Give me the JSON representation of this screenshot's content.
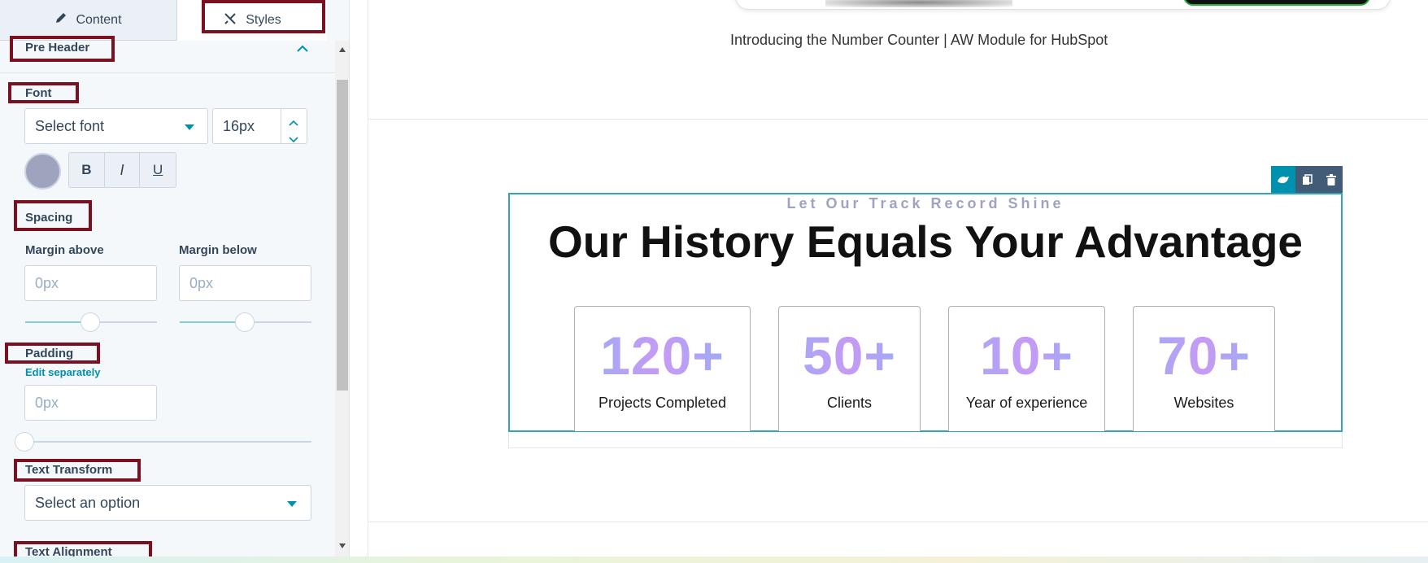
{
  "tabs": {
    "content": "Content",
    "styles": "Styles"
  },
  "pre_header": {
    "title": "Pre Header"
  },
  "font": {
    "label": "Font",
    "select_placeholder": "Select font",
    "size_value": "16px",
    "bold": "B",
    "italic": "I",
    "underline": "U",
    "color": "#a0a3bd"
  },
  "spacing": {
    "label": "Spacing",
    "margin_above_label": "Margin above",
    "margin_below_label": "Margin below",
    "margin_above_placeholder": "0px",
    "margin_below_placeholder": "0px"
  },
  "padding": {
    "label": "Padding",
    "edit_separately": "Edit separately",
    "placeholder": "0px"
  },
  "text_transform": {
    "label": "Text Transform",
    "select_placeholder": "Select an option"
  },
  "text_alignment": {
    "label": "Text Alignment"
  },
  "canvas": {
    "caption": "Introducing the Number Counter | AW Module for HubSpot",
    "pre_header": "Let Our Track Record Shine",
    "heading": "Our History Equals Your Advantage",
    "stats": [
      {
        "number": "120+",
        "label": "Projects Completed"
      },
      {
        "number": "50+",
        "label": "Clients"
      },
      {
        "number": "10+",
        "label": "Year of experience"
      },
      {
        "number": "70+",
        "label": "Websites"
      }
    ]
  },
  "colors": {
    "accent": "#0091ae",
    "highlight_border": "#7a1020",
    "module_toolbar_active": "#0091ae",
    "module_toolbar": "#425b76"
  },
  "icons": [
    "pencil-icon",
    "styles-icon",
    "chevron-up-icon",
    "caret-down-icon",
    "stepper-up-icon",
    "stepper-down-icon",
    "drag-icon",
    "clone-icon",
    "trash-icon"
  ]
}
